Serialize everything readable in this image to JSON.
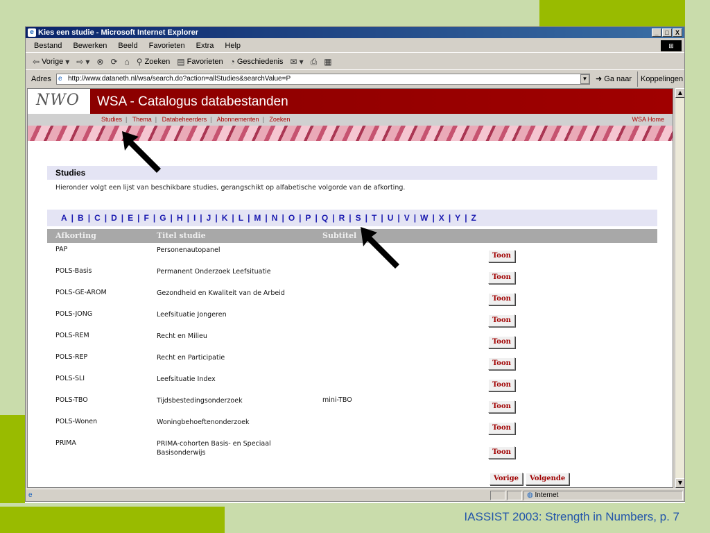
{
  "window": {
    "title": "Kies een studie - Microsoft Internet Explorer",
    "min_label": "_",
    "max_label": "□",
    "close_label": "X"
  },
  "menubar": {
    "items": [
      "Bestand",
      "Bewerken",
      "Beeld",
      "Favorieten",
      "Extra",
      "Help"
    ]
  },
  "toolbar": {
    "back": "Vorige",
    "search": "Zoeken",
    "favorites": "Favorieten",
    "history": "Geschiedenis"
  },
  "addressbar": {
    "label": "Adres",
    "url": "http://www.dataneth.nl/wsa/search.do?action=allStudies&searchValue=P",
    "go": "Ga naar",
    "links": "Koppelingen"
  },
  "site": {
    "logo": "NWO",
    "title": "WSA - Catalogus databestanden",
    "nav": [
      "Studies",
      "Thema",
      "Databeheerders",
      "Abonnementen",
      "Zoeken"
    ],
    "home": "WSA Home"
  },
  "section": {
    "title": "Studies",
    "intro": "Hieronder volgt een lijst van beschikbare studies, gerangschikt op alfabetische volgorde van de afkorting."
  },
  "alphabet": [
    "A",
    "B",
    "C",
    "D",
    "E",
    "F",
    "G",
    "H",
    "I",
    "J",
    "K",
    "L",
    "M",
    "N",
    "O",
    "P",
    "Q",
    "R",
    "S",
    "T",
    "U",
    "V",
    "W",
    "X",
    "Y",
    "Z"
  ],
  "table": {
    "headers": [
      "Afkorting",
      "Titel studie",
      "Subtitel"
    ],
    "button_label": "Toon",
    "rows": [
      {
        "abbr": "PAP",
        "title": "Personenautopanel",
        "subtitle": ""
      },
      {
        "abbr": "POLS-Basis",
        "title": "Permanent Onderzoek Leefsituatie",
        "subtitle": ""
      },
      {
        "abbr": "POLS-GE-AROM",
        "title": "Gezondheid en Kwaliteit van de Arbeid",
        "subtitle": ""
      },
      {
        "abbr": "POLS-JONG",
        "title": "Leefsituatie Jongeren",
        "subtitle": ""
      },
      {
        "abbr": "POLS-REM",
        "title": "Recht en Milieu",
        "subtitle": ""
      },
      {
        "abbr": "POLS-REP",
        "title": "Recht en Participatie",
        "subtitle": ""
      },
      {
        "abbr": "POLS-SLI",
        "title": "Leefsituatie Index",
        "subtitle": ""
      },
      {
        "abbr": "POLS-TBO",
        "title": "Tijdsbestedingsonderzoek",
        "subtitle": "mini-TBO"
      },
      {
        "abbr": "POLS-Wonen",
        "title": "Woningbehoeftenonderzoek",
        "subtitle": ""
      },
      {
        "abbr": "PRIMA",
        "title": "PRIMA-cohorten Basis- en Speciaal Basisonderwijs",
        "subtitle": ""
      }
    ],
    "prev": "Vorige",
    "next": "Volgende"
  },
  "statusbar": {
    "zone": "Internet"
  },
  "slide": {
    "caption": "IASSIST 2003: Strength in Numbers, p. 7"
  },
  "colors": {
    "accent_green": "#99bb00",
    "light_green": "#c9dcab",
    "nwo_red": "#8b0000",
    "link_blue": "#1a1ab0"
  }
}
